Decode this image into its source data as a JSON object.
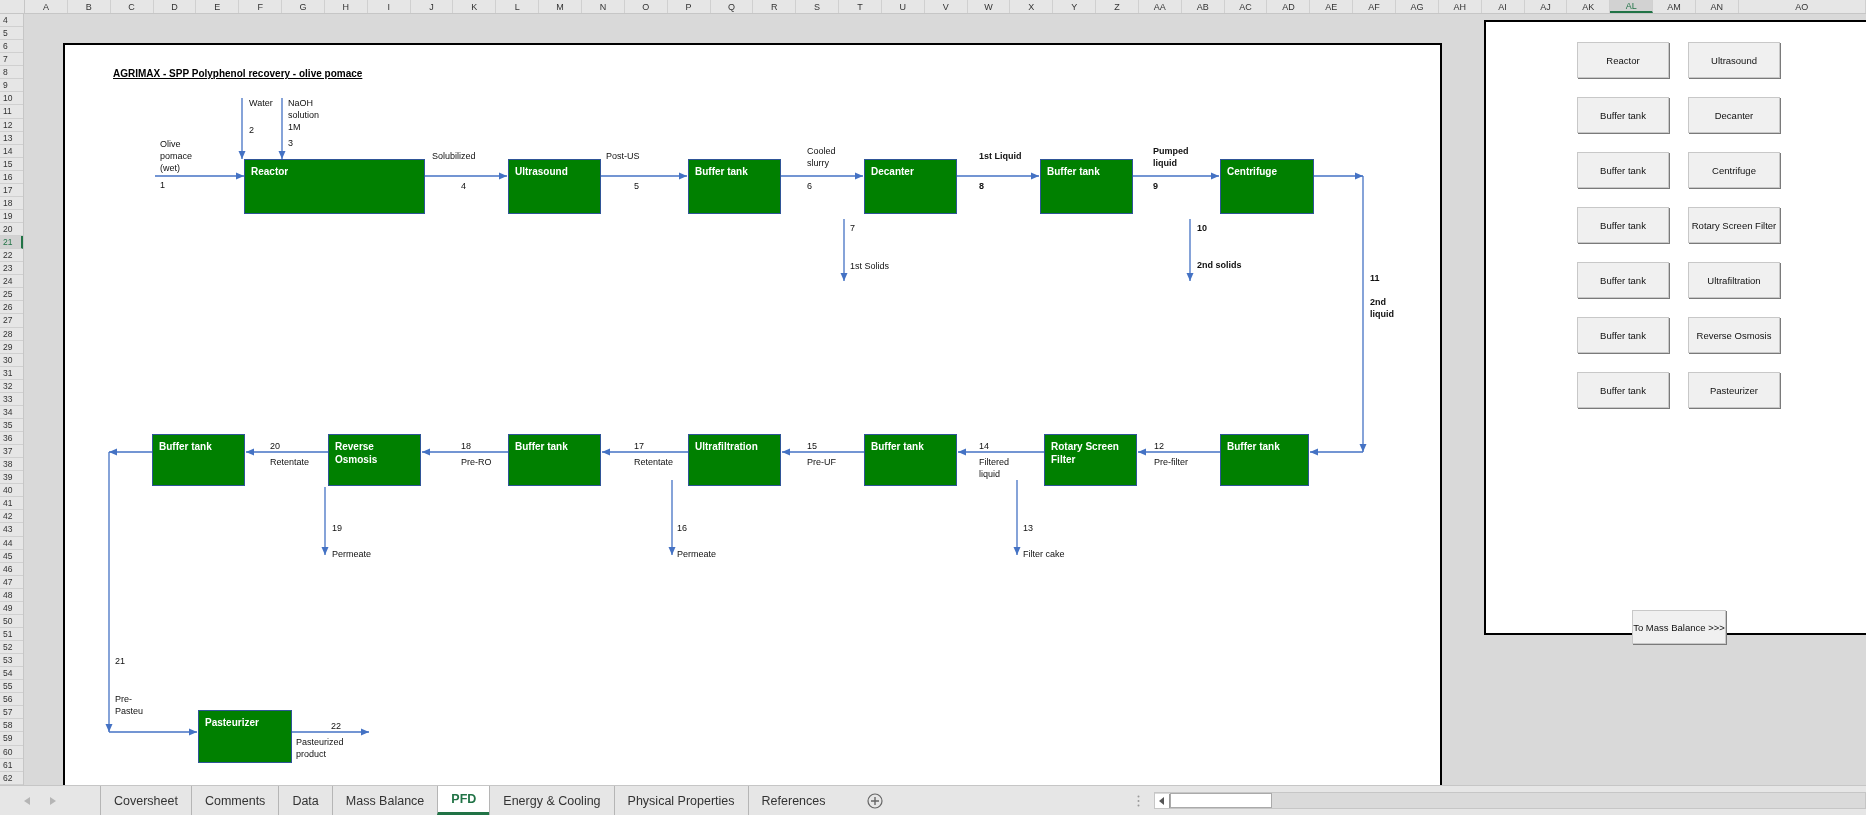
{
  "columns": [
    {
      "label": "A",
      "selected": false
    },
    {
      "label": "B",
      "selected": false
    },
    {
      "label": "C",
      "selected": false
    },
    {
      "label": "D",
      "selected": false
    },
    {
      "label": "E",
      "selected": false
    },
    {
      "label": "F",
      "selected": false
    },
    {
      "label": "G",
      "selected": false
    },
    {
      "label": "H",
      "selected": false
    },
    {
      "label": "I",
      "selected": false
    },
    {
      "label": "J",
      "selected": false
    },
    {
      "label": "K",
      "selected": false
    },
    {
      "label": "L",
      "selected": false
    },
    {
      "label": "M",
      "selected": false
    },
    {
      "label": "N",
      "selected": false
    },
    {
      "label": "O",
      "selected": false
    },
    {
      "label": "P",
      "selected": false
    },
    {
      "label": "Q",
      "selected": false
    },
    {
      "label": "R",
      "selected": false
    },
    {
      "label": "S",
      "selected": false
    },
    {
      "label": "T",
      "selected": false
    },
    {
      "label": "U",
      "selected": false
    },
    {
      "label": "V",
      "selected": false
    },
    {
      "label": "W",
      "selected": false
    },
    {
      "label": "X",
      "selected": false
    },
    {
      "label": "Y",
      "selected": false
    },
    {
      "label": "Z",
      "selected": false
    },
    {
      "label": "AA",
      "selected": false
    },
    {
      "label": "AB",
      "selected": false
    },
    {
      "label": "AC",
      "selected": false
    },
    {
      "label": "AD",
      "selected": false
    },
    {
      "label": "AE",
      "selected": false
    },
    {
      "label": "AF",
      "selected": false
    },
    {
      "label": "AG",
      "selected": false
    },
    {
      "label": "AH",
      "selected": false
    },
    {
      "label": "AI",
      "selected": false
    },
    {
      "label": "AJ",
      "selected": false
    },
    {
      "label": "AK",
      "selected": false
    },
    {
      "label": "AL",
      "selected": true
    },
    {
      "label": "AM",
      "selected": false
    },
    {
      "label": "AN",
      "selected": false
    },
    {
      "label": "AO",
      "selected": false
    }
  ],
  "rows": [
    {
      "label": "4",
      "selected": false
    },
    {
      "label": "5",
      "selected": false
    },
    {
      "label": "6",
      "selected": false
    },
    {
      "label": "7",
      "selected": false
    },
    {
      "label": "8",
      "selected": false
    },
    {
      "label": "9",
      "selected": false
    },
    {
      "label": "10",
      "selected": false
    },
    {
      "label": "11",
      "selected": false
    },
    {
      "label": "12",
      "selected": false
    },
    {
      "label": "13",
      "selected": false
    },
    {
      "label": "14",
      "selected": false
    },
    {
      "label": "15",
      "selected": false
    },
    {
      "label": "16",
      "selected": false
    },
    {
      "label": "17",
      "selected": false
    },
    {
      "label": "18",
      "selected": false
    },
    {
      "label": "19",
      "selected": false
    },
    {
      "label": "20",
      "selected": false
    },
    {
      "label": "21",
      "selected": true
    },
    {
      "label": "22",
      "selected": false
    },
    {
      "label": "23",
      "selected": false
    },
    {
      "label": "24",
      "selected": false
    },
    {
      "label": "25",
      "selected": false
    },
    {
      "label": "26",
      "selected": false
    },
    {
      "label": "27",
      "selected": false
    },
    {
      "label": "28",
      "selected": false
    },
    {
      "label": "29",
      "selected": false
    },
    {
      "label": "30",
      "selected": false
    },
    {
      "label": "31",
      "selected": false
    },
    {
      "label": "32",
      "selected": false
    },
    {
      "label": "33",
      "selected": false
    },
    {
      "label": "34",
      "selected": false
    },
    {
      "label": "35",
      "selected": false
    },
    {
      "label": "36",
      "selected": false
    },
    {
      "label": "37",
      "selected": false
    },
    {
      "label": "38",
      "selected": false
    },
    {
      "label": "39",
      "selected": false
    },
    {
      "label": "40",
      "selected": false
    },
    {
      "label": "41",
      "selected": false
    },
    {
      "label": "42",
      "selected": false
    },
    {
      "label": "43",
      "selected": false
    },
    {
      "label": "44",
      "selected": false
    },
    {
      "label": "45",
      "selected": false
    },
    {
      "label": "46",
      "selected": false
    },
    {
      "label": "47",
      "selected": false
    },
    {
      "label": "48",
      "selected": false
    },
    {
      "label": "49",
      "selected": false
    },
    {
      "label": "50",
      "selected": false
    },
    {
      "label": "51",
      "selected": false
    },
    {
      "label": "52",
      "selected": false
    },
    {
      "label": "53",
      "selected": false
    },
    {
      "label": "54",
      "selected": false
    },
    {
      "label": "55",
      "selected": false
    },
    {
      "label": "56",
      "selected": false
    },
    {
      "label": "57",
      "selected": false
    },
    {
      "label": "58",
      "selected": false
    },
    {
      "label": "59",
      "selected": false
    },
    {
      "label": "60",
      "selected": false
    },
    {
      "label": "61",
      "selected": false
    },
    {
      "label": "62",
      "selected": false
    }
  ],
  "diagram": {
    "title": "AGRIMAX - SPP Polyphenol recovery - olive pomace",
    "units": [
      {
        "label": "Reactor"
      },
      {
        "label": "Ultrasound"
      },
      {
        "label": "Buffer tank"
      },
      {
        "label": "Decanter"
      },
      {
        "label": "Buffer tank"
      },
      {
        "label": "Centrifuge"
      },
      {
        "label": "Buffer tank"
      },
      {
        "label": "Reverse Osmosis"
      },
      {
        "label": "Buffer tank"
      },
      {
        "label": "Ultrafiltration"
      },
      {
        "label": "Buffer tank"
      },
      {
        "label": "Rotary Screen Filter"
      },
      {
        "label": "Buffer tank"
      },
      {
        "label": "Pasteurizer"
      }
    ],
    "streams": [
      {
        "number": "1",
        "label": "Olive pomace (wet)",
        "bold": false
      },
      {
        "number": "2",
        "label": "Water",
        "bold": false
      },
      {
        "number": "3",
        "label": "NaOH solution 1M",
        "bold": false
      },
      {
        "number": "4",
        "label": "Solubilized",
        "bold": false
      },
      {
        "number": "5",
        "label": "Post-US",
        "bold": false
      },
      {
        "number": "6",
        "label": "Cooled slurry",
        "bold": false
      },
      {
        "number": "7",
        "label": "1st Solids",
        "bold": false
      },
      {
        "number": "8",
        "label": "1st Liquid",
        "bold": true
      },
      {
        "number": "9",
        "label": "Pumped liquid",
        "bold": true
      },
      {
        "number": "10",
        "label": "2nd solids",
        "bold": true
      },
      {
        "number": "11",
        "label": "2nd liquid",
        "bold": true
      },
      {
        "number": "20",
        "label": "Retentate",
        "bold": false
      },
      {
        "number": "18",
        "label": "Pre-RO",
        "bold": false
      },
      {
        "number": "17",
        "label": "Retentate",
        "bold": false
      },
      {
        "number": "15",
        "label": "Pre-UF",
        "bold": false
      },
      {
        "number": "14",
        "label": "Filtered liquid",
        "bold": false
      },
      {
        "number": "12",
        "label": "Pre-filter",
        "bold": false
      },
      {
        "number": "19",
        "label": "Permeate",
        "bold": false
      },
      {
        "number": "16",
        "label": "Permeate",
        "bold": false
      },
      {
        "number": "13",
        "label": "Filter cake",
        "bold": false
      },
      {
        "number": "21",
        "label": "Pre-Pasteu",
        "bold": false
      },
      {
        "number": "22",
        "label": "Pasteurized product",
        "bold": false
      }
    ]
  },
  "panel": {
    "buttons": [
      "Reactor",
      "Ultrasound",
      "Buffer tank",
      "Decanter",
      "Buffer tank",
      "Centrifuge",
      "Buffer tank",
      "Rotary Screen Filter",
      "Buffer tank",
      "Ultrafiltration",
      "Buffer tank",
      "Reverse Osmosis",
      "Buffer tank",
      "Pasteurizer"
    ],
    "nav_button": "To Mass Balance >>>"
  },
  "sheet_tabs": [
    {
      "label": "Coversheet",
      "selected": false
    },
    {
      "label": "Comments",
      "selected": false
    },
    {
      "label": "Data",
      "selected": false
    },
    {
      "label": "Mass Balance",
      "selected": false
    },
    {
      "label": "PFD",
      "selected": true
    },
    {
      "label": "Energy & Cooling",
      "selected": false
    },
    {
      "label": "Physical Properties",
      "selected": false
    },
    {
      "label": "References",
      "selected": false
    }
  ]
}
